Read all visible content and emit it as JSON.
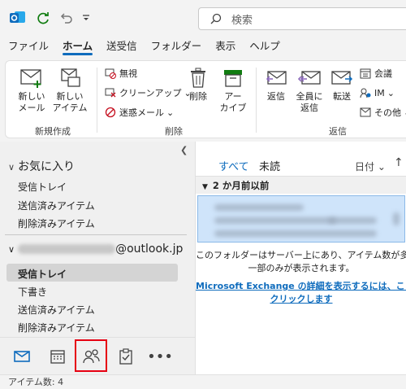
{
  "search": {
    "placeholder": "検索"
  },
  "menu": {
    "tabs": [
      "ファイル",
      "ホーム",
      "送受信",
      "フォルダー",
      "表示",
      "ヘルプ"
    ],
    "active": "ホーム"
  },
  "ribbon": {
    "new_mail": "新しい\nメール",
    "new_item": "新しい\nアイテム",
    "group_new": "新規作成",
    "ignore": "無視",
    "cleanup": "クリーンアップ",
    "junk": "迷惑メール",
    "delete": "削除",
    "archive": "アー\nカイブ",
    "group_delete": "削除",
    "reply": "返信",
    "reply_all": "全員に\n返信",
    "forward": "転送",
    "meeting": "会議",
    "im": "IM",
    "more": "その他",
    "group_respond": "返信"
  },
  "folders": {
    "favorites_label": "お気に入り",
    "favorites": [
      "受信トレイ",
      "送信済みアイテム",
      "削除済みアイテム"
    ],
    "account_suffix": "@outlook.jp",
    "account_folders": [
      "受信トレイ",
      "下書き",
      "送信済みアイテム",
      "削除済みアイテム"
    ],
    "selected": "受信トレイ"
  },
  "list": {
    "tab_all": "すべて",
    "tab_unread": "未読",
    "sort": "日付",
    "group_header": "2 か月前以前",
    "info_line1": "このフォルダーはサーバー上にあり、アイテム数が多いため",
    "info_line2": "一部のみが表示されます。",
    "link_line1": "Microsoft Exchange の詳細を表示するには、ここを",
    "link_line2": "クリックします"
  },
  "status": {
    "text": "アイテム数: 4"
  },
  "colors": {
    "accent": "#0f6cbd",
    "highlight": "#e60012"
  }
}
